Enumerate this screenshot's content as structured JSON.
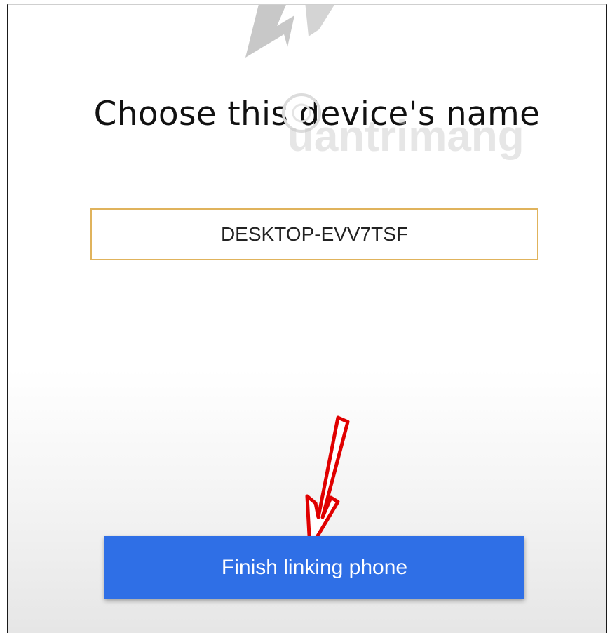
{
  "dialog": {
    "title": "Choose this device's name",
    "device_name_value": "DESKTOP-EVV7TSF",
    "finish_button_label": "Finish linking phone"
  },
  "watermark": {
    "text": "uantrimang"
  },
  "colors": {
    "button_bg": "#2f6fe6",
    "button_text": "#ffffff",
    "input_border": "#e0b35c",
    "arrow": "#e00000"
  }
}
